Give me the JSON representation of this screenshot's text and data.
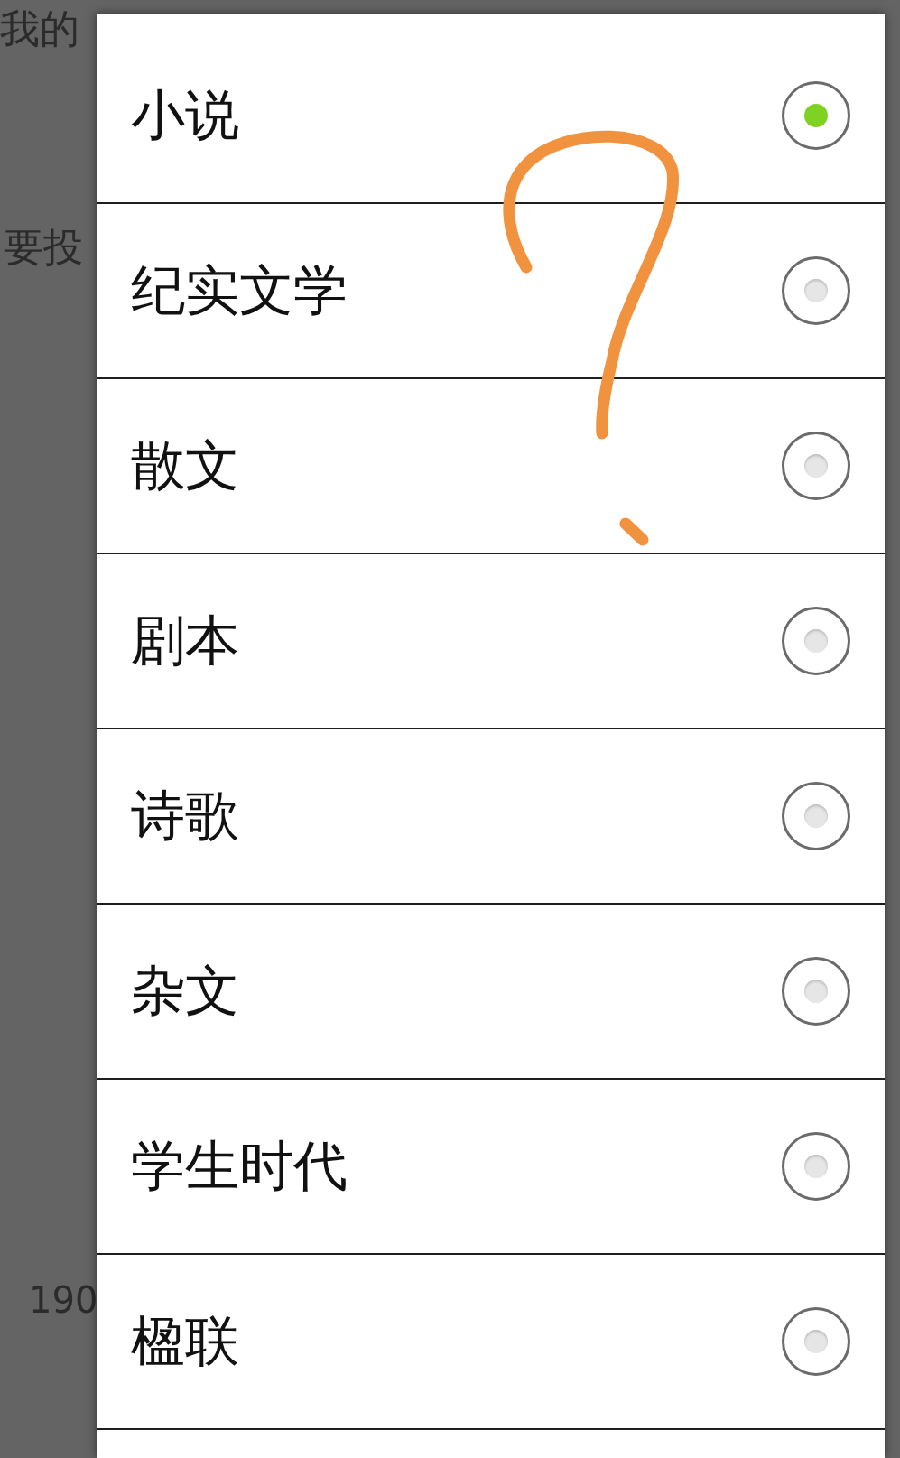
{
  "background": {
    "texts": [
      "我的",
      "要投",
      "190"
    ]
  },
  "dialog": {
    "options": [
      {
        "label": "小说",
        "selected": true
      },
      {
        "label": "纪实文学",
        "selected": false
      },
      {
        "label": "散文",
        "selected": false
      },
      {
        "label": "剧本",
        "selected": false
      },
      {
        "label": "诗歌",
        "selected": false
      },
      {
        "label": "杂文",
        "selected": false
      },
      {
        "label": "学生时代",
        "selected": false
      },
      {
        "label": "楹联",
        "selected": false
      }
    ]
  }
}
